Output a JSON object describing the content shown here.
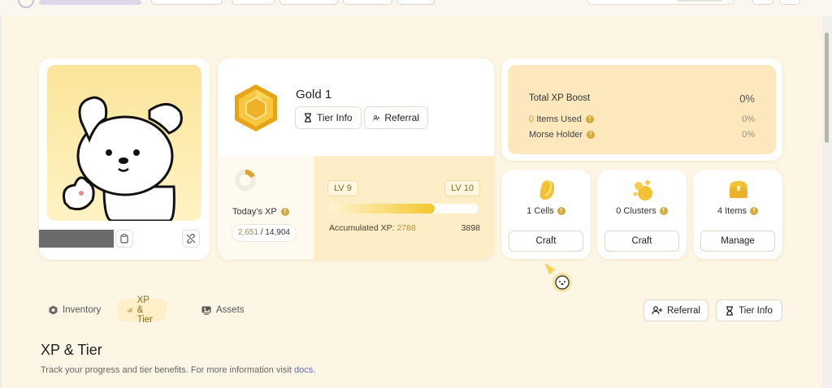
{
  "tier": {
    "name": "Gold 1",
    "tier_info_label": "Tier Info",
    "referral_label": "Referral"
  },
  "today_xp": {
    "label": "Today's XP",
    "current": "2,651",
    "separator": " / ",
    "max": "14,904",
    "progress_fraction": 0.18
  },
  "level": {
    "current_label": "LV 9",
    "next_label": "LV 10",
    "progress_fraction": 0.71,
    "accumulated_label": "Accumulated XP:",
    "accumulated_value": "2788",
    "target_value": "3898"
  },
  "boost": {
    "title": "Total XP Boost",
    "title_value": "0%",
    "items_used_count": "0",
    "items_used_label": "Items Used",
    "items_used_value": "0%",
    "morse_label": "Morse Holder",
    "morse_value": "0%"
  },
  "cells": {
    "label": "1 Cells",
    "button": "Craft"
  },
  "clusters": {
    "label": "0 Clusters",
    "button": "Craft"
  },
  "items": {
    "label": "4 Items",
    "button": "Manage"
  },
  "tabs": [
    {
      "label": "Inventory",
      "icon": "hexagon-icon",
      "active": false
    },
    {
      "label": "XP & Tier",
      "icon": "bar-chart-icon",
      "active": true
    },
    {
      "label": "Assets",
      "icon": "image-icon",
      "active": false
    }
  ],
  "actions": {
    "referral_label": "Referral",
    "tier_info_label": "Tier Info"
  },
  "section": {
    "title": "XP & Tier",
    "desc_prefix": "Track your progress and tier benefits. For more information visit ",
    "docs_link": "docs",
    "desc_suffix": "."
  },
  "colors": {
    "accent_gold": "#f5c62b",
    "page_bg": "#fdf6e4",
    "boost_bg": "#fde8bd",
    "level_bg": "#fdeec7"
  }
}
